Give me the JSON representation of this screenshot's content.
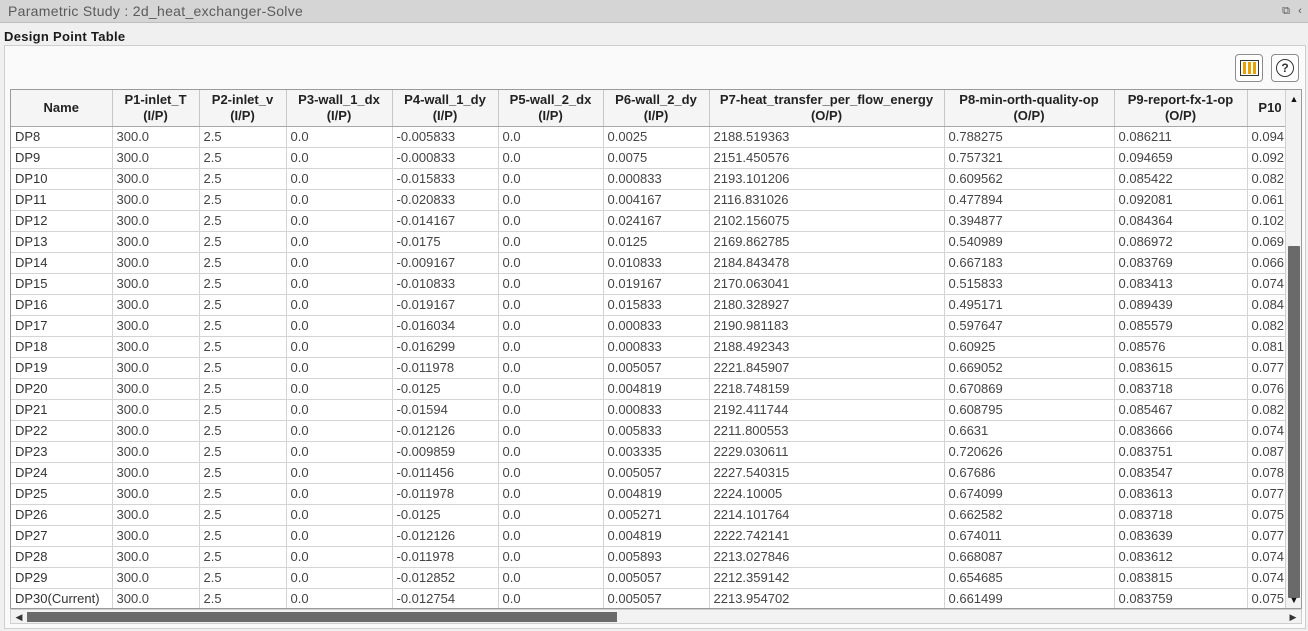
{
  "window": {
    "title": "Parametric Study : 2d_heat_exchanger-Solve",
    "restore_glyph": "⧉",
    "collapse_glyph": "‹"
  },
  "section": {
    "title": "Design Point Table"
  },
  "toolbar": {
    "columns_icon": "columns-icon",
    "help_icon": "help-icon",
    "help_glyph": "?"
  },
  "table": {
    "columns": [
      {
        "label": "Name",
        "sub": ""
      },
      {
        "label": "P1-inlet_T",
        "sub": "(I/P)"
      },
      {
        "label": "P2-inlet_v",
        "sub": "(I/P)"
      },
      {
        "label": "P3-wall_1_dx",
        "sub": "(I/P)"
      },
      {
        "label": "P4-wall_1_dy",
        "sub": "(I/P)"
      },
      {
        "label": "P5-wall_2_dx",
        "sub": "(I/P)"
      },
      {
        "label": "P6-wall_2_dy",
        "sub": "(I/P)"
      },
      {
        "label": "P7-heat_transfer_per_flow_energy",
        "sub": "(O/P)"
      },
      {
        "label": "P8-min-orth-quality-op",
        "sub": "(O/P)"
      },
      {
        "label": "P9-report-fx-1-op",
        "sub": "(O/P)"
      },
      {
        "label": "P10",
        "sub": ""
      }
    ],
    "rows": [
      [
        "DP8",
        "300.0",
        "2.5",
        "0.0",
        "-0.005833",
        "0.0",
        "0.0025",
        "2188.519363",
        "0.788275",
        "0.086211",
        "0.094"
      ],
      [
        "DP9",
        "300.0",
        "2.5",
        "0.0",
        "-0.000833",
        "0.0",
        "0.0075",
        "2151.450576",
        "0.757321",
        "0.094659",
        "0.092"
      ],
      [
        "DP10",
        "300.0",
        "2.5",
        "0.0",
        "-0.015833",
        "0.0",
        "0.000833",
        "2193.101206",
        "0.609562",
        "0.085422",
        "0.082"
      ],
      [
        "DP11",
        "300.0",
        "2.5",
        "0.0",
        "-0.020833",
        "0.0",
        "0.004167",
        "2116.831026",
        "0.477894",
        "0.092081",
        "0.061"
      ],
      [
        "DP12",
        "300.0",
        "2.5",
        "0.0",
        "-0.014167",
        "0.0",
        "0.024167",
        "2102.156075",
        "0.394877",
        "0.084364",
        "0.102"
      ],
      [
        "DP13",
        "300.0",
        "2.5",
        "0.0",
        "-0.0175",
        "0.0",
        "0.0125",
        "2169.862785",
        "0.540989",
        "0.086972",
        "0.069"
      ],
      [
        "DP14",
        "300.0",
        "2.5",
        "0.0",
        "-0.009167",
        "0.0",
        "0.010833",
        "2184.843478",
        "0.667183",
        "0.083769",
        "0.066"
      ],
      [
        "DP15",
        "300.0",
        "2.5",
        "0.0",
        "-0.010833",
        "0.0",
        "0.019167",
        "2170.063041",
        "0.515833",
        "0.083413",
        "0.074"
      ],
      [
        "DP16",
        "300.0",
        "2.5",
        "0.0",
        "-0.019167",
        "0.0",
        "0.015833",
        "2180.328927",
        "0.495171",
        "0.089439",
        "0.084"
      ],
      [
        "DP17",
        "300.0",
        "2.5",
        "0.0",
        "-0.016034",
        "0.0",
        "0.000833",
        "2190.981183",
        "0.597647",
        "0.085579",
        "0.082"
      ],
      [
        "DP18",
        "300.0",
        "2.5",
        "0.0",
        "-0.016299",
        "0.0",
        "0.000833",
        "2188.492343",
        "0.60925",
        "0.08576",
        "0.081"
      ],
      [
        "DP19",
        "300.0",
        "2.5",
        "0.0",
        "-0.011978",
        "0.0",
        "0.005057",
        "2221.845907",
        "0.669052",
        "0.083615",
        "0.077"
      ],
      [
        "DP20",
        "300.0",
        "2.5",
        "0.0",
        "-0.0125",
        "0.0",
        "0.004819",
        "2218.748159",
        "0.670869",
        "0.083718",
        "0.076"
      ],
      [
        "DP21",
        "300.0",
        "2.5",
        "0.0",
        "-0.01594",
        "0.0",
        "0.000833",
        "2192.411744",
        "0.608795",
        "0.085467",
        "0.082"
      ],
      [
        "DP22",
        "300.0",
        "2.5",
        "0.0",
        "-0.012126",
        "0.0",
        "0.005833",
        "2211.800553",
        "0.6631",
        "0.083666",
        "0.074"
      ],
      [
        "DP23",
        "300.0",
        "2.5",
        "0.0",
        "-0.009859",
        "0.0",
        "0.003335",
        "2229.030611",
        "0.720626",
        "0.083751",
        "0.087"
      ],
      [
        "DP24",
        "300.0",
        "2.5",
        "0.0",
        "-0.011456",
        "0.0",
        "0.005057",
        "2227.540315",
        "0.67686",
        "0.083547",
        "0.078"
      ],
      [
        "DP25",
        "300.0",
        "2.5",
        "0.0",
        "-0.011978",
        "0.0",
        "0.004819",
        "2224.10005",
        "0.674099",
        "0.083613",
        "0.077"
      ],
      [
        "DP26",
        "300.0",
        "2.5",
        "0.0",
        "-0.0125",
        "0.0",
        "0.005271",
        "2214.101764",
        "0.662582",
        "0.083718",
        "0.075"
      ],
      [
        "DP27",
        "300.0",
        "2.5",
        "0.0",
        "-0.012126",
        "0.0",
        "0.004819",
        "2222.742141",
        "0.674011",
        "0.083639",
        "0.077"
      ],
      [
        "DP28",
        "300.0",
        "2.5",
        "0.0",
        "-0.011978",
        "0.0",
        "0.005893",
        "2213.027846",
        "0.668087",
        "0.083612",
        "0.074"
      ],
      [
        "DP29",
        "300.0",
        "2.5",
        "0.0",
        "-0.012852",
        "0.0",
        "0.005057",
        "2212.359142",
        "0.654685",
        "0.083815",
        "0.074"
      ],
      [
        "DP30(Current)",
        "300.0",
        "2.5",
        "0.0",
        "-0.012754",
        "0.0",
        "0.005057",
        "2213.954702",
        "0.661499",
        "0.083759",
        "0.075"
      ]
    ]
  },
  "scrollbars": {
    "up": "▲",
    "down": "▼",
    "left": "◀",
    "right": "▶"
  }
}
